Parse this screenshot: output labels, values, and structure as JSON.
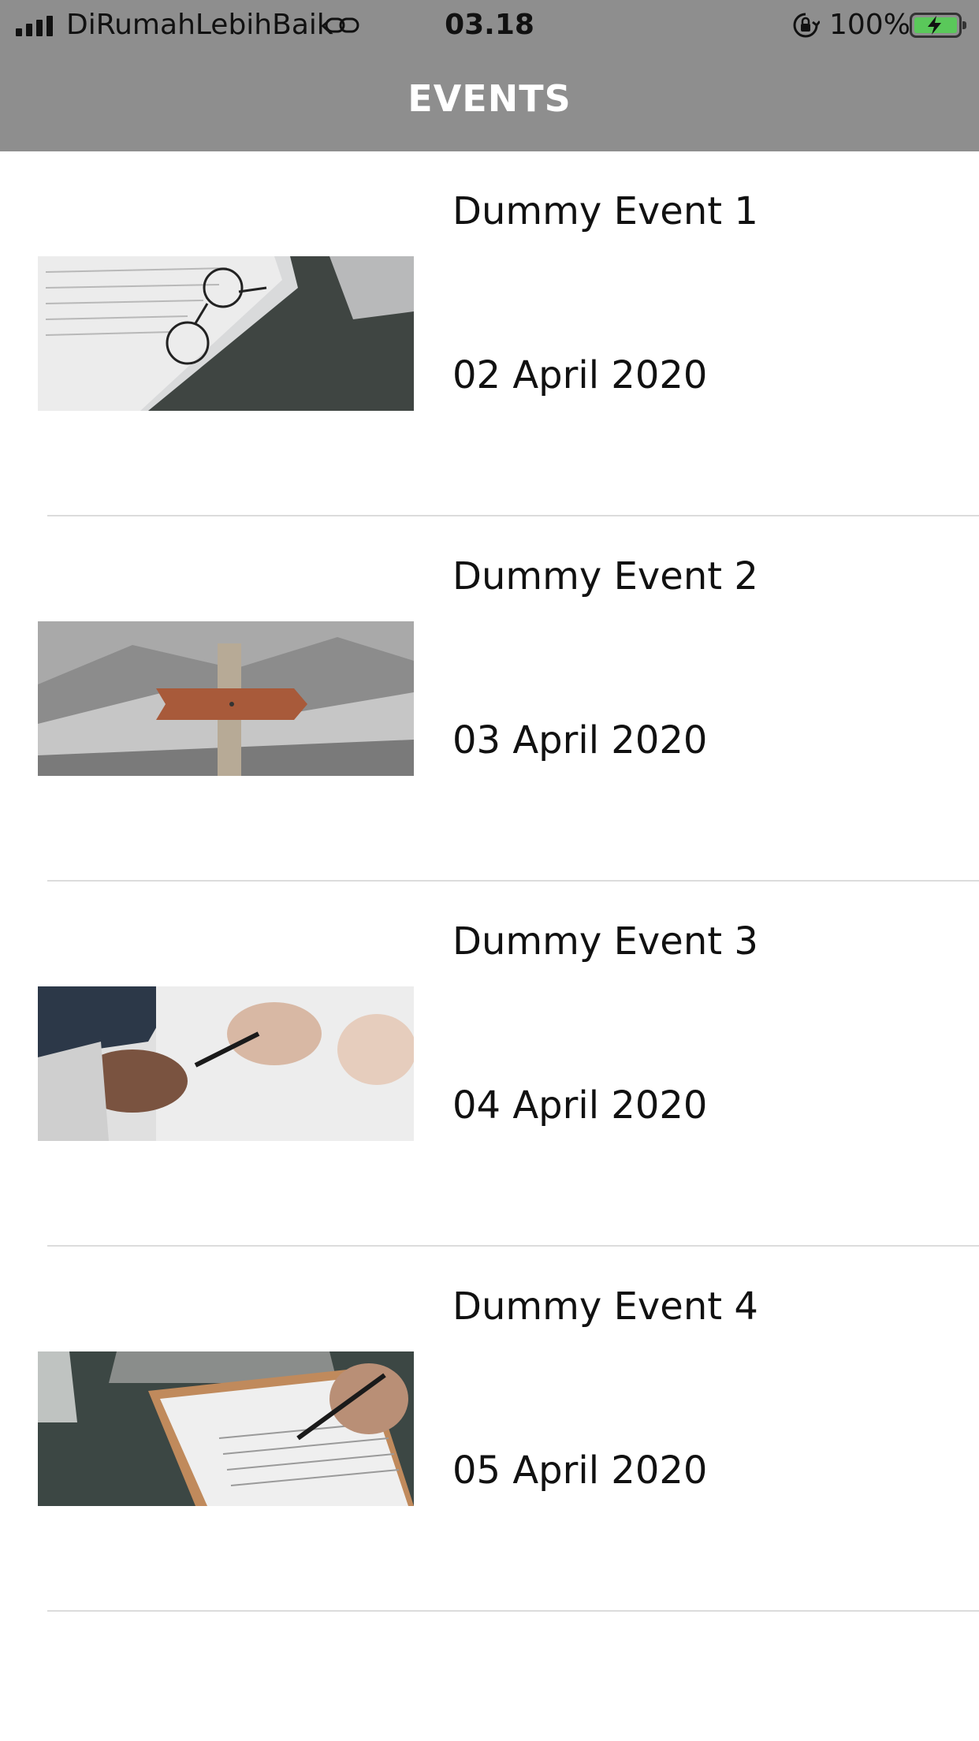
{
  "status_bar": {
    "carrier": "DiRumahLebihBaik",
    "time": "03.18",
    "battery": "100%"
  },
  "header": {
    "title": "EVENTS"
  },
  "events": [
    {
      "title": "Dummy Event 1",
      "date": "02 April 2020"
    },
    {
      "title": "Dummy Event 2",
      "date": "03 April 2020"
    },
    {
      "title": "Dummy Event 3",
      "date": "04 April 2020"
    },
    {
      "title": "Dummy Event 4",
      "date": "05 April 2020"
    }
  ]
}
